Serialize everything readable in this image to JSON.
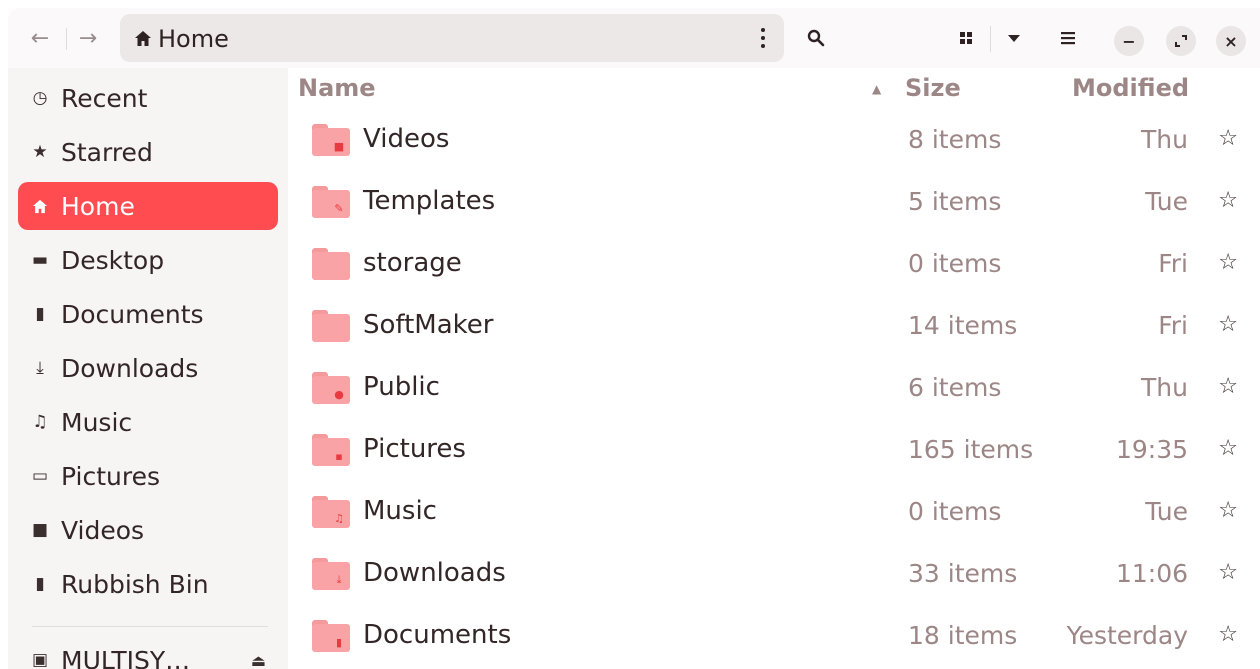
{
  "header": {
    "path_label": "Home"
  },
  "sidebar": {
    "items": [
      {
        "label": "Recent",
        "icon": "clock-icon",
        "glyph": "◷"
      },
      {
        "label": "Starred",
        "icon": "star-icon",
        "glyph": "★"
      },
      {
        "label": "Home",
        "icon": "home-icon",
        "glyph": "⌂"
      },
      {
        "label": "Desktop",
        "icon": "desktop-icon",
        "glyph": "▬"
      },
      {
        "label": "Documents",
        "icon": "document-icon",
        "glyph": "▮"
      },
      {
        "label": "Downloads",
        "icon": "download-icon",
        "glyph": "⤓"
      },
      {
        "label": "Music",
        "icon": "music-icon",
        "glyph": "♫"
      },
      {
        "label": "Pictures",
        "icon": "picture-icon",
        "glyph": "▭"
      },
      {
        "label": "Videos",
        "icon": "video-icon",
        "glyph": "■"
      },
      {
        "label": "Rubbish Bin",
        "icon": "trash-icon",
        "glyph": "▮"
      },
      {
        "label": "MULTISY…",
        "icon": "drive-icon",
        "glyph": "▣"
      }
    ],
    "active": "Home"
  },
  "columns": {
    "name": "Name",
    "size": "Size",
    "modified": "Modified"
  },
  "files": [
    {
      "name": "Videos",
      "size": "8 items",
      "modified": "Thu",
      "emblem": "video-emblem-icon",
      "glyph": "■"
    },
    {
      "name": "Templates",
      "size": "5 items",
      "modified": "Tue",
      "emblem": "template-emblem-icon",
      "glyph": "✎"
    },
    {
      "name": "storage",
      "size": "0 items",
      "modified": "Fri",
      "emblem": "",
      "glyph": ""
    },
    {
      "name": "SoftMaker",
      "size": "14 items",
      "modified": "Fri",
      "emblem": "",
      "glyph": ""
    },
    {
      "name": "Public",
      "size": "6 items",
      "modified": "Thu",
      "emblem": "person-emblem-icon",
      "glyph": "●"
    },
    {
      "name": "Pictures",
      "size": "165 items",
      "modified": "19:35",
      "emblem": "picture-emblem-icon",
      "glyph": "▪"
    },
    {
      "name": "Music",
      "size": "0 items",
      "modified": "Tue",
      "emblem": "music-emblem-icon",
      "glyph": "♫"
    },
    {
      "name": "Downloads",
      "size": "33 items",
      "modified": "11:06",
      "emblem": "download-emblem-icon",
      "glyph": "⤓"
    },
    {
      "name": "Documents",
      "size": "18 items",
      "modified": "Yesterday",
      "emblem": "document-emblem-icon",
      "glyph": "▮"
    }
  ],
  "colors": {
    "accent": "#ff4c50",
    "folder": "#f9a3a6",
    "muted_text": "#9c8686"
  }
}
